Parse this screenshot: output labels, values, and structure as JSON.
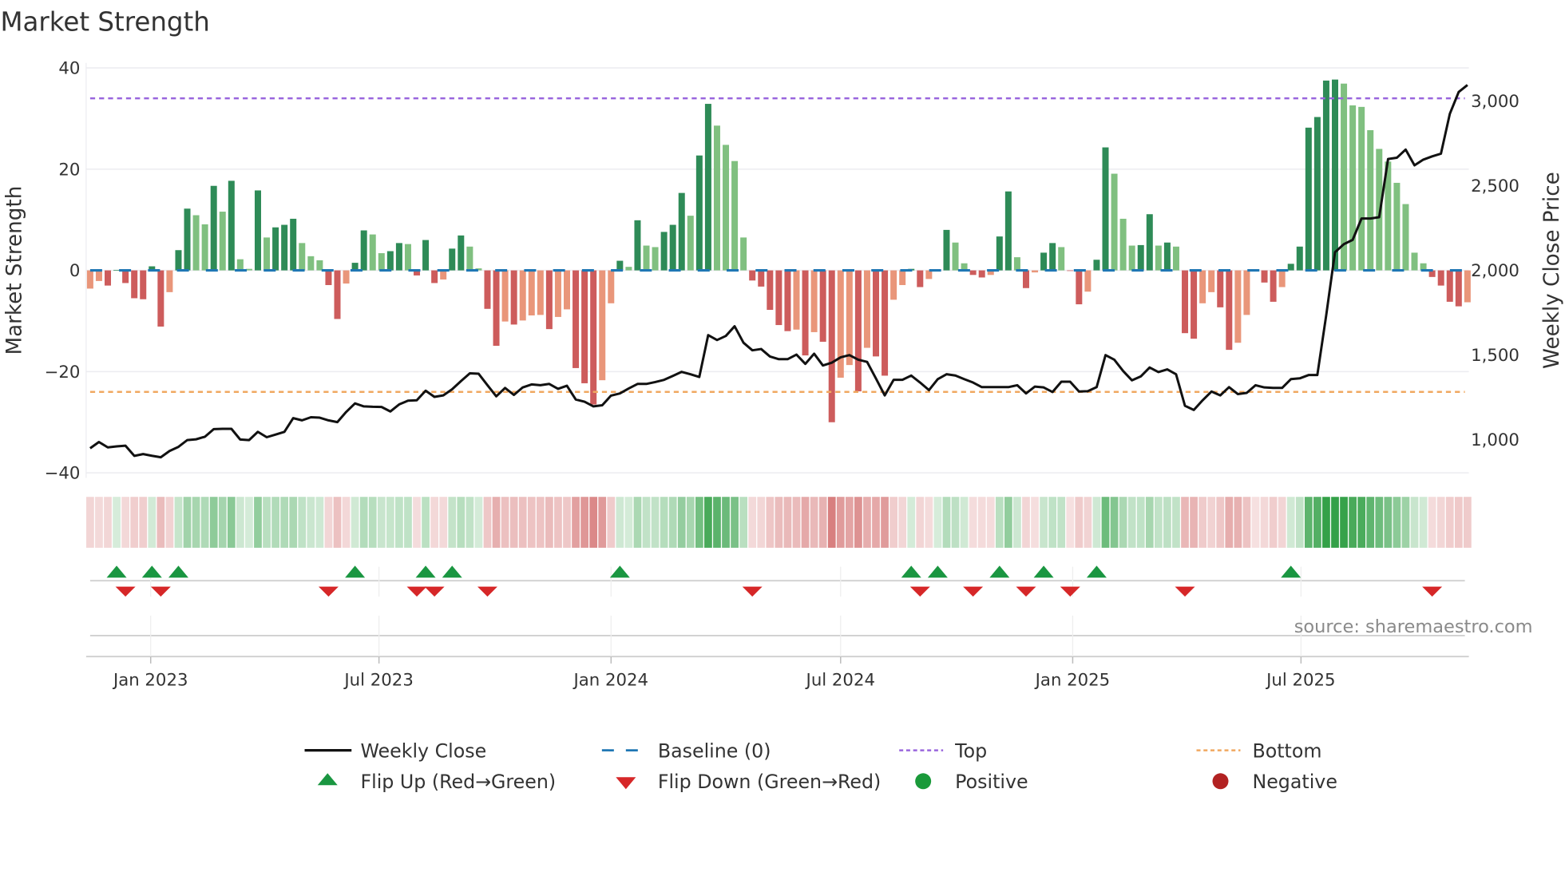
{
  "title": "Market Strength",
  "source": "source: sharemaestro.com",
  "legend": {
    "weekly_close": "Weekly Close",
    "baseline": "Baseline (0)",
    "top": "Top",
    "bottom": "Bottom",
    "flip_up": "Flip Up (Red→Green)",
    "flip_down": "Flip Down (Green→Red)",
    "positive": "Positive",
    "negative": "Negative"
  },
  "colors": {
    "rising_positive": "#2e8b57",
    "falling_positive": "#80c080",
    "falling_negative": "#cd5c5c",
    "rising_negative": "#e9967a",
    "close_line": "#111111",
    "baseline": "#1f77b4",
    "top": "#9966dd",
    "bottom": "#f0a860",
    "flip_up": "#1a9641",
    "flip_down": "#d62728",
    "positive": "#1a9a3a",
    "negative": "#b22222"
  },
  "chart_data": {
    "type": "bar",
    "title": "Market Strength",
    "ylabel": "Market Strength",
    "y2label": "Weekly Close Price",
    "ylim": [
      -41,
      41
    ],
    "y2lim": [
      775,
      3225
    ],
    "grid": true,
    "legend_position": "bottom",
    "yticks": [
      {
        "value": 40,
        "label": "40"
      },
      {
        "value": 20,
        "label": "20"
      },
      {
        "value": 0,
        "label": "0"
      },
      {
        "value": -20,
        "label": "−20"
      },
      {
        "value": -40,
        "label": "−40"
      }
    ],
    "y2ticks": [
      {
        "value": 3000,
        "label": "3,000"
      },
      {
        "value": 2500,
        "label": "2,500"
      },
      {
        "value": 2000,
        "label": "2,000"
      },
      {
        "value": 1500,
        "label": "1,500"
      },
      {
        "value": 1000,
        "label": "1,000"
      }
    ],
    "xticks": [
      {
        "date": "2023-01-01",
        "label": "Jan 2023"
      },
      {
        "date": "2023-07-01",
        "label": "Jul 2023"
      },
      {
        "date": "2024-01-01",
        "label": "Jan 2024"
      },
      {
        "date": "2024-07-01",
        "label": "Jul 2024"
      },
      {
        "date": "2025-01-01",
        "label": "Jan 2025"
      },
      {
        "date": "2025-07-01",
        "label": "Jul 2025"
      }
    ],
    "top_level": 34,
    "bottom_level": -24,
    "dates": [
      "2022-11-14",
      "2022-11-21",
      "2022-11-28",
      "2022-12-05",
      "2022-12-12",
      "2022-12-19",
      "2022-12-26",
      "2023-01-02",
      "2023-01-09",
      "2023-01-16",
      "2023-01-23",
      "2023-01-30",
      "2023-02-06",
      "2023-02-13",
      "2023-02-20",
      "2023-02-27",
      "2023-03-06",
      "2023-03-13",
      "2023-03-20",
      "2023-03-27",
      "2023-04-03",
      "2023-04-10",
      "2023-04-17",
      "2023-04-24",
      "2023-05-01",
      "2023-05-08",
      "2023-05-15",
      "2023-05-22",
      "2023-05-29",
      "2023-06-05",
      "2023-06-12",
      "2023-06-19",
      "2023-06-26",
      "2023-07-03",
      "2023-07-10",
      "2023-07-17",
      "2023-07-24",
      "2023-07-31",
      "2023-08-07",
      "2023-08-14",
      "2023-08-21",
      "2023-08-28",
      "2023-09-04",
      "2023-09-11",
      "2023-09-18",
      "2023-09-25",
      "2023-10-02",
      "2023-10-09",
      "2023-10-16",
      "2023-10-23",
      "2023-10-30",
      "2023-11-06",
      "2023-11-13",
      "2023-11-20",
      "2023-11-27",
      "2023-12-04",
      "2023-12-11",
      "2023-12-18",
      "2023-12-25",
      "2024-01-01",
      "2024-01-08",
      "2024-01-15",
      "2024-01-22",
      "2024-01-29",
      "2024-02-05",
      "2024-02-12",
      "2024-02-19",
      "2024-02-26",
      "2024-03-04",
      "2024-03-11",
      "2024-03-18",
      "2024-03-25",
      "2024-04-01",
      "2024-04-08",
      "2024-04-15",
      "2024-04-22",
      "2024-04-29",
      "2024-05-06",
      "2024-05-13",
      "2024-05-20",
      "2024-05-27",
      "2024-06-03",
      "2024-06-10",
      "2024-06-17",
      "2024-06-24",
      "2024-07-01",
      "2024-07-08",
      "2024-07-15",
      "2024-07-22",
      "2024-07-29",
      "2024-08-05",
      "2024-08-12",
      "2024-08-19",
      "2024-08-26",
      "2024-09-02",
      "2024-09-09",
      "2024-09-16",
      "2024-09-23",
      "2024-09-30",
      "2024-10-07",
      "2024-10-14",
      "2024-10-21",
      "2024-10-28",
      "2024-11-04",
      "2024-11-11",
      "2024-11-18",
      "2024-11-25",
      "2024-12-02",
      "2024-12-09",
      "2024-12-16",
      "2024-12-23",
      "2024-12-30",
      "2025-01-06",
      "2025-01-13",
      "2025-01-20",
      "2025-01-27",
      "2025-02-03",
      "2025-02-10",
      "2025-02-17",
      "2025-02-24",
      "2025-03-03",
      "2025-03-10",
      "2025-03-17",
      "2025-03-24",
      "2025-03-31",
      "2025-04-07",
      "2025-04-14",
      "2025-04-21",
      "2025-04-28",
      "2025-05-05",
      "2025-05-12",
      "2025-05-19",
      "2025-05-26",
      "2025-06-02",
      "2025-06-09",
      "2025-06-16",
      "2025-06-23",
      "2025-06-30",
      "2025-07-07",
      "2025-07-14",
      "2025-07-21",
      "2025-07-28",
      "2025-08-04",
      "2025-08-11",
      "2025-08-18",
      "2025-08-25",
      "2025-09-01",
      "2025-09-08",
      "2025-09-15",
      "2025-09-22",
      "2025-09-29",
      "2025-10-06",
      "2025-10-13",
      "2025-10-20",
      "2025-10-27",
      "2025-11-03",
      "2025-11-10"
    ],
    "strength": [
      -3.6,
      -2.1,
      -3.0,
      0.1,
      -2.5,
      -5.5,
      -5.7,
      0.8,
      -11.1,
      -4.3,
      4.0,
      12.2,
      10.9,
      9.1,
      16.7,
      11.6,
      17.7,
      2.2,
      0.3,
      15.8,
      6.5,
      8.5,
      9.0,
      10.2,
      5.4,
      2.8,
      2.0,
      -2.9,
      -9.6,
      -2.6,
      1.5,
      7.9,
      7.1,
      3.4,
      3.8,
      5.4,
      5.2,
      -1.0,
      6.0,
      -2.5,
      -1.8,
      4.3,
      6.9,
      4.7,
      0.4,
      -7.6,
      -14.9,
      -10.1,
      -10.7,
      -9.9,
      -8.9,
      -8.8,
      -11.6,
      -9.2,
      -7.7,
      -19.3,
      -22.3,
      -26.5,
      -21.7,
      -6.5,
      1.9,
      0.7,
      9.9,
      4.9,
      4.6,
      7.6,
      9.0,
      15.3,
      10.8,
      22.7,
      32.9,
      28.6,
      24.8,
      21.6,
      6.5,
      -2.0,
      -3.2,
      -7.8,
      -10.8,
      -12.0,
      -11.7,
      -16.8,
      -12.2,
      -14.1,
      -30.0,
      -21.2,
      -18.7,
      -23.9,
      -15.3,
      -17.0,
      -20.8,
      -5.8,
      -2.9,
      0.3,
      -3.3,
      -1.7,
      0.2,
      8.0,
      5.5,
      1.4,
      -0.9,
      -1.4,
      -0.9,
      6.7,
      15.6,
      2.6,
      -3.5,
      -0.4,
      3.5,
      5.4,
      4.6,
      -0.1,
      -6.7,
      -4.2,
      2.1,
      24.3,
      19.1,
      10.2,
      4.9,
      5.0,
      11.1,
      4.9,
      5.5,
      4.7,
      -12.4,
      -13.5,
      -6.5,
      -4.3,
      -7.3,
      -15.7,
      -14.3,
      -8.8,
      -0.2,
      -2.4,
      -6.2,
      -3.3,
      1.3,
      4.7,
      28.2,
      30.3,
      37.5,
      37.7,
      36.9,
      32.6,
      32.3,
      27.7,
      24.0,
      21.5,
      17.3,
      13.1,
      3.5,
      1.4,
      -1.3,
      -3.0,
      -6.2,
      -7.1,
      -6.3
    ],
    "close": [
      950,
      987,
      955,
      961,
      965,
      905,
      916,
      906,
      897,
      934,
      958,
      998,
      1003,
      1018,
      1063,
      1065,
      1065,
      1002,
      998,
      1047,
      1015,
      1031,
      1047,
      1128,
      1115,
      1133,
      1131,
      1115,
      1104,
      1164,
      1215,
      1197,
      1195,
      1194,
      1167,
      1209,
      1231,
      1233,
      1290,
      1253,
      1262,
      1298,
      1346,
      1392,
      1390,
      1322,
      1257,
      1306,
      1265,
      1309,
      1327,
      1322,
      1330,
      1301,
      1319,
      1238,
      1225,
      1197,
      1204,
      1261,
      1274,
      1303,
      1330,
      1330,
      1341,
      1354,
      1377,
      1401,
      1387,
      1371,
      1618,
      1589,
      1613,
      1670,
      1573,
      1528,
      1536,
      1492,
      1476,
      1476,
      1503,
      1448,
      1508,
      1439,
      1455,
      1487,
      1500,
      1473,
      1460,
      1363,
      1262,
      1354,
      1354,
      1379,
      1338,
      1293,
      1358,
      1387,
      1379,
      1358,
      1338,
      1311,
      1311,
      1311,
      1311,
      1322,
      1274,
      1314,
      1309,
      1282,
      1343,
      1343,
      1285,
      1287,
      1311,
      1500,
      1473,
      1406,
      1351,
      1374,
      1427,
      1400,
      1416,
      1387,
      1201,
      1176,
      1233,
      1285,
      1262,
      1311,
      1270,
      1277,
      1322,
      1309,
      1306,
      1306,
      1358,
      1363,
      1382,
      1382,
      1735,
      2107,
      2155,
      2180,
      2306,
      2306,
      2314,
      2657,
      2665,
      2713,
      2620,
      2654,
      2673,
      2689,
      2924,
      3053,
      3094
    ],
    "flip_up": [
      "2022-12-05",
      "2023-01-02",
      "2023-01-23",
      "2023-06-12",
      "2023-08-07",
      "2023-08-28",
      "2024-01-08",
      "2024-08-26",
      "2024-09-16",
      "2024-11-04",
      "2024-12-09",
      "2025-01-20",
      "2025-06-23"
    ],
    "flip_down": [
      "2022-12-12",
      "2023-01-09",
      "2023-05-22",
      "2023-07-31",
      "2023-08-14",
      "2023-09-25",
      "2024-04-22",
      "2024-09-02",
      "2024-10-14",
      "2024-11-25",
      "2024-12-30",
      "2025-03-31",
      "2025-10-13"
    ]
  }
}
